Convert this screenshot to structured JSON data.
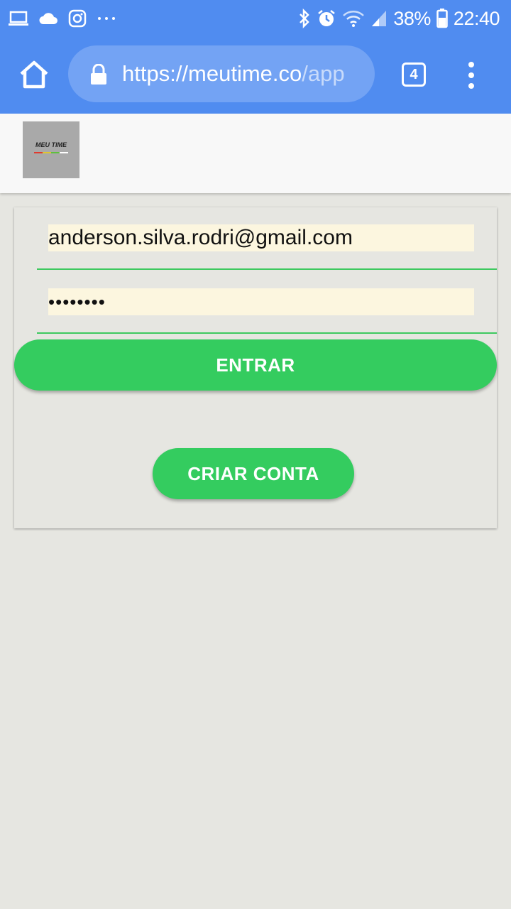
{
  "status_bar": {
    "battery_percent": "38%",
    "time": "22:40",
    "icons_left": [
      "laptop-icon",
      "cloud-icon",
      "instagram-icon",
      "more-dots-icon"
    ],
    "icons_right": [
      "bluetooth-icon",
      "alarm-icon",
      "wifi-icon",
      "signal-icon",
      "battery-icon"
    ]
  },
  "browser": {
    "url_host": "https://meutime.co",
    "url_path": "/app",
    "tab_count": "4"
  },
  "app": {
    "logo_text": "MEU TIME",
    "logo_stripe_colors": [
      "#e03a2f",
      "#e0c531",
      "#5fbf3f",
      "#ffffff"
    ]
  },
  "login": {
    "email_value": "anderson.silva.rodri@gmail.com",
    "password_value": "••••••••",
    "login_button_label": "ENTRAR",
    "create_account_button_label": "CRIAR CONTA"
  },
  "colors": {
    "browser_bar": "#508cf0",
    "accent_green": "#34cc5f",
    "background": "#e6e6e1",
    "field_fill": "#fcf6df"
  }
}
